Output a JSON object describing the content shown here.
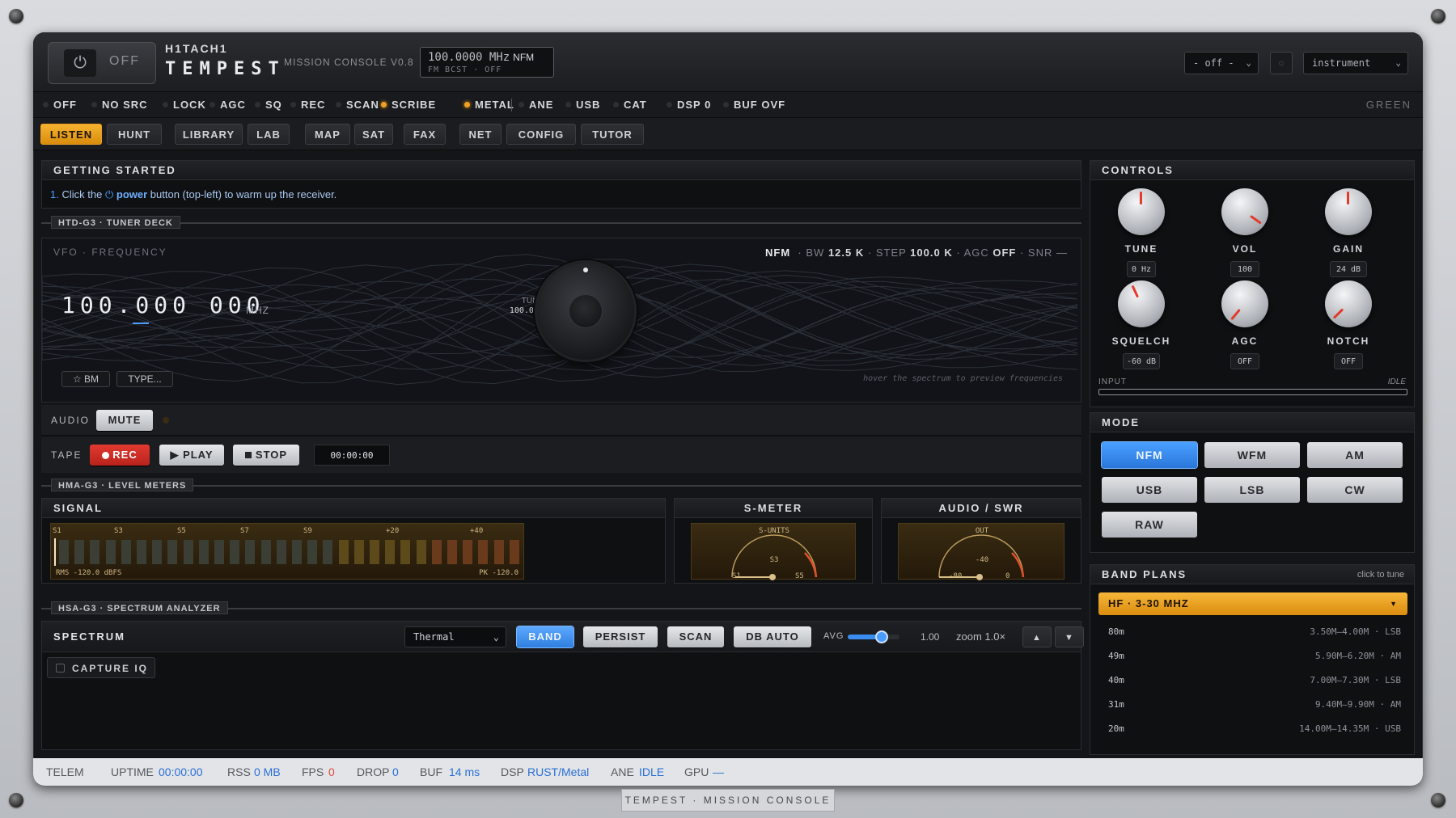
{
  "header": {
    "power_label": "OFF",
    "brand_top": "H1TACH1",
    "brand_name": "TEMPEST",
    "version": "MISSION CONSOLE V0.8",
    "freq_display": "100.0000 MHz",
    "freq_mode": "NFM",
    "freq_sub": "FM BCST · OFF",
    "select_left": "- off -",
    "select_right": "instrument",
    "square_button": "○"
  },
  "status_leds": [
    {
      "label": "OFF",
      "on": false
    },
    {
      "label": "NO SRC",
      "on": false
    },
    {
      "label": "LOCK",
      "on": false
    },
    {
      "label": "AGC",
      "on": false
    },
    {
      "label": "SQ",
      "on": false
    },
    {
      "label": "REC",
      "on": false
    },
    {
      "label": "SCAN",
      "on": false
    },
    {
      "label": "SCRIBE",
      "on": true
    },
    {
      "label": "METAL",
      "on": true
    },
    {
      "label": "ANE",
      "on": false
    },
    {
      "label": "USB",
      "on": false
    },
    {
      "label": "CAT",
      "on": false
    },
    {
      "label": "DSP 0",
      "on": false
    },
    {
      "label": "BUF OVF",
      "on": false
    }
  ],
  "theme_label": "GREEN",
  "nav_tabs": [
    "LISTEN",
    "HUNT",
    "LIBRARY",
    "LAB",
    "MAP",
    "SAT",
    "FAX",
    "NET",
    "CONFIG",
    "TUTOR"
  ],
  "getting_started": {
    "title": "GETTING STARTED",
    "step_num": "1.",
    "text_before": "Click the",
    "power_word": "power",
    "text_after": "button (top-left) to warm up the receiver."
  },
  "tuner": {
    "section": "HTD-G3 · TUNER DECK",
    "vfo_label": "VFO · FREQUENCY",
    "mode": "NFM",
    "bw_label": "BW",
    "bw": "12.5 K",
    "step_label": "STEP",
    "step": "100.0 K",
    "agc_label": "AGC",
    "agc": "OFF",
    "snr_label": "SNR",
    "snr": "—",
    "digits": "100.000 000",
    "unit": "MHZ",
    "tune_label": "TUNE",
    "tune_step": "100.0 k",
    "bm_button": "☆ BM",
    "type_button": "TYPE...",
    "hover_hint": "hover the spectrum to preview frequencies"
  },
  "audio": {
    "label": "AUDIO",
    "mute": "MUTE"
  },
  "tape": {
    "label": "TAPE",
    "rec": "REC",
    "play": "▶ PLAY",
    "stop": "STOP",
    "time": "00:00:00"
  },
  "meters": {
    "section": "HMA-G3 · LEVEL METERS",
    "signal_title": "SIGNAL",
    "signal_ticks": [
      "S1",
      "S3",
      "S5",
      "S7",
      "S9",
      "+20",
      "+40"
    ],
    "rms": "RMS -120.0 dBFS",
    "pk": "PK -120.0",
    "smeter_title": "S-METER",
    "smeter_caption": "S-UNITS",
    "smeter_center": "S3",
    "smeter_left": "S1",
    "smeter_right": "S5",
    "audio_title": "AUDIO / SWR",
    "audio_caption": "OUT",
    "audio_center": "-40",
    "audio_left": "-80",
    "audio_right": "0"
  },
  "spectrum": {
    "section": "HSA-G3 · SPECTRUM ANALYZER",
    "title": "SPECTRUM",
    "palette": "Thermal",
    "band": "BAND",
    "persist": "PERSIST",
    "scan": "SCAN",
    "db_auto": "DB AUTO",
    "avg_label": "AVG",
    "avg_value": "1.00",
    "avg_fraction": 0.65,
    "zoom": "zoom 1.0×",
    "up": "▲",
    "down": "▼",
    "capture": "CAPTURE IQ"
  },
  "controls": {
    "title": "CONTROLS",
    "knobs": [
      {
        "label": "TUNE",
        "value": "0 Hz"
      },
      {
        "label": "VOL",
        "value": "100"
      },
      {
        "label": "GAIN",
        "value": "24 dB"
      },
      {
        "label": "SQUELCH",
        "value": "-60 dB"
      },
      {
        "label": "AGC",
        "value": "OFF"
      },
      {
        "label": "NOTCH",
        "value": "OFF"
      }
    ],
    "input_label": "INPUT",
    "input_state": "IDLE"
  },
  "mode_panel": {
    "title": "MODE",
    "modes": [
      "NFM",
      "WFM",
      "AM",
      "USB",
      "LSB",
      "CW",
      "RAW"
    ],
    "active": "NFM"
  },
  "band_plans": {
    "title": "BAND PLANS",
    "hint": "click to tune",
    "selected": "HF · 3-30 MHZ",
    "rows": [
      {
        "name": "80m",
        "range": "3.50M–4.00M · LSB"
      },
      {
        "name": "49m",
        "range": "5.90M–6.20M · AM"
      },
      {
        "name": "40m",
        "range": "7.00M–7.30M · LSB"
      },
      {
        "name": "31m",
        "range": "9.40M–9.90M · AM"
      },
      {
        "name": "20m",
        "range": "14.00M–14.35M · USB"
      }
    ]
  },
  "telemetry": {
    "label": "TELEM",
    "uptime_label": "UPTIME",
    "uptime": "00:00:00",
    "rss_label": "RSS",
    "rss": "0 MB",
    "fps_label": "FPS",
    "fps": "0",
    "drop_label": "DROP",
    "drop": "0",
    "buf_label": "BUF",
    "buf": "14 ms",
    "dsp_label": "DSP",
    "dsp": "RUST/Metal",
    "ane_label": "ANE",
    "ane": "IDLE",
    "gpu_label": "GPU",
    "gpu": "—"
  },
  "footer": "TEMPEST · MISSION CONSOLE",
  "colors": {
    "accent": "#f0a020",
    "blue": "#2f7fe0",
    "red": "#d42f26",
    "panel": "#141518"
  }
}
